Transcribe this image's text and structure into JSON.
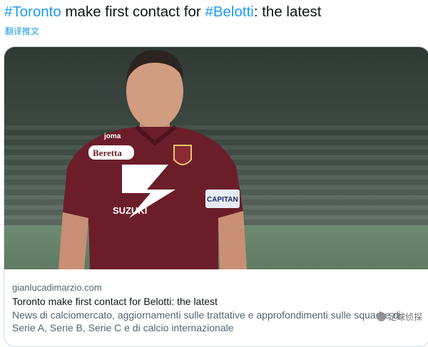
{
  "tweet": {
    "hashtag1": "#Toronto",
    "text1": " make first contact for ",
    "hashtag2": "#Belotti",
    "text2": ": the latest",
    "translate_label": "翻译推文"
  },
  "card": {
    "image_alt": "Player in maroon Torino kit with captain armband",
    "jersey_texts": [
      "joma",
      "Beretta",
      "SUZUKI",
      "CAPITAN"
    ],
    "source": "gianlucadimarzio.com",
    "title": "Toronto make first contact for Belotti: the latest",
    "description": "News di calciomercato, aggiornamenti sulle trattative e approfondimenti sulle squadre di Serie A, Serie B, Serie C e di calcio internazionale"
  },
  "watermark": {
    "text": "足球侦探"
  },
  "colors": {
    "link": "#1d9bf0",
    "text": "#0f1419",
    "secondary": "#536471",
    "jersey": "#6b1e2a"
  }
}
